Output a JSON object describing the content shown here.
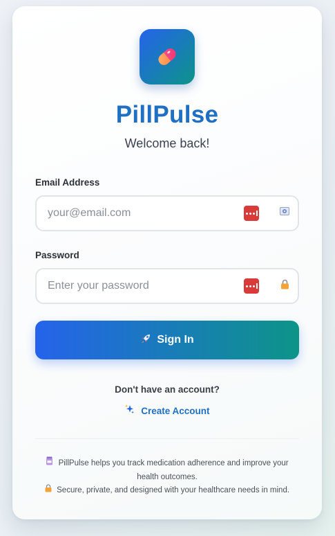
{
  "app": {
    "name": "PillPulse",
    "welcome": "Welcome back!",
    "logo_icon": "pill-icon",
    "colors": {
      "brand": "#1f6fc2",
      "gradient_start": "#2563eb",
      "gradient_end": "#0d9488",
      "password_manager": "#d93a3a"
    }
  },
  "form": {
    "email": {
      "label": "Email Address",
      "placeholder": "your@email.com",
      "value": "",
      "icon": "envelope-icon"
    },
    "password": {
      "label": "Password",
      "placeholder": "Enter your password",
      "value": "",
      "icon": "lock-icon"
    },
    "password_manager_icon": "password-manager-icon",
    "submit": {
      "label": "Sign In",
      "icon": "rocket-icon"
    }
  },
  "signup": {
    "prompt": "Don't have an account?",
    "link": "Create Account",
    "icon": "sparkles-icon"
  },
  "footer": {
    "line1": "PillPulse helps you track medication adherence and improve your",
    "line2": "health outcomes.",
    "line3": "Secure, private, and designed with your healthcare needs in mind.",
    "icon1": "pill-bottle-icon",
    "icon3": "lock-icon"
  }
}
